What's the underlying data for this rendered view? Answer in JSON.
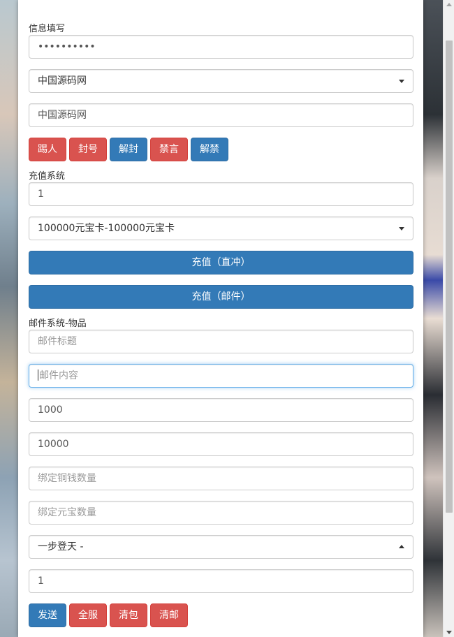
{
  "info": {
    "label": "信息填写",
    "password_value": "••••••••••",
    "server_select": "中国源码网",
    "role_input": "中国源码网",
    "buttons": [
      "踢人",
      "封号",
      "解封",
      "禁言",
      "解禁"
    ]
  },
  "recharge": {
    "label": "充值系统",
    "amount": "1",
    "item_select": "100000元宝卡-100000元宝卡",
    "direct_button": "充值（直冲）",
    "mail_button": "充值（邮件）"
  },
  "mail": {
    "label": "邮件系统-物品",
    "title_placeholder": "邮件标题",
    "content_placeholder": "邮件内容",
    "field3_value": "1000",
    "field4_value": "10000",
    "bound_copper_placeholder": "绑定铜钱数量",
    "bound_yuanbao_placeholder": "绑定元宝数量",
    "item_select": "一步登天 -",
    "quantity": "1",
    "buttons": [
      "发送",
      "全服",
      "清包",
      "清邮"
    ]
  },
  "colors": {
    "primary": "#337ab7",
    "danger": "#d9534f"
  }
}
